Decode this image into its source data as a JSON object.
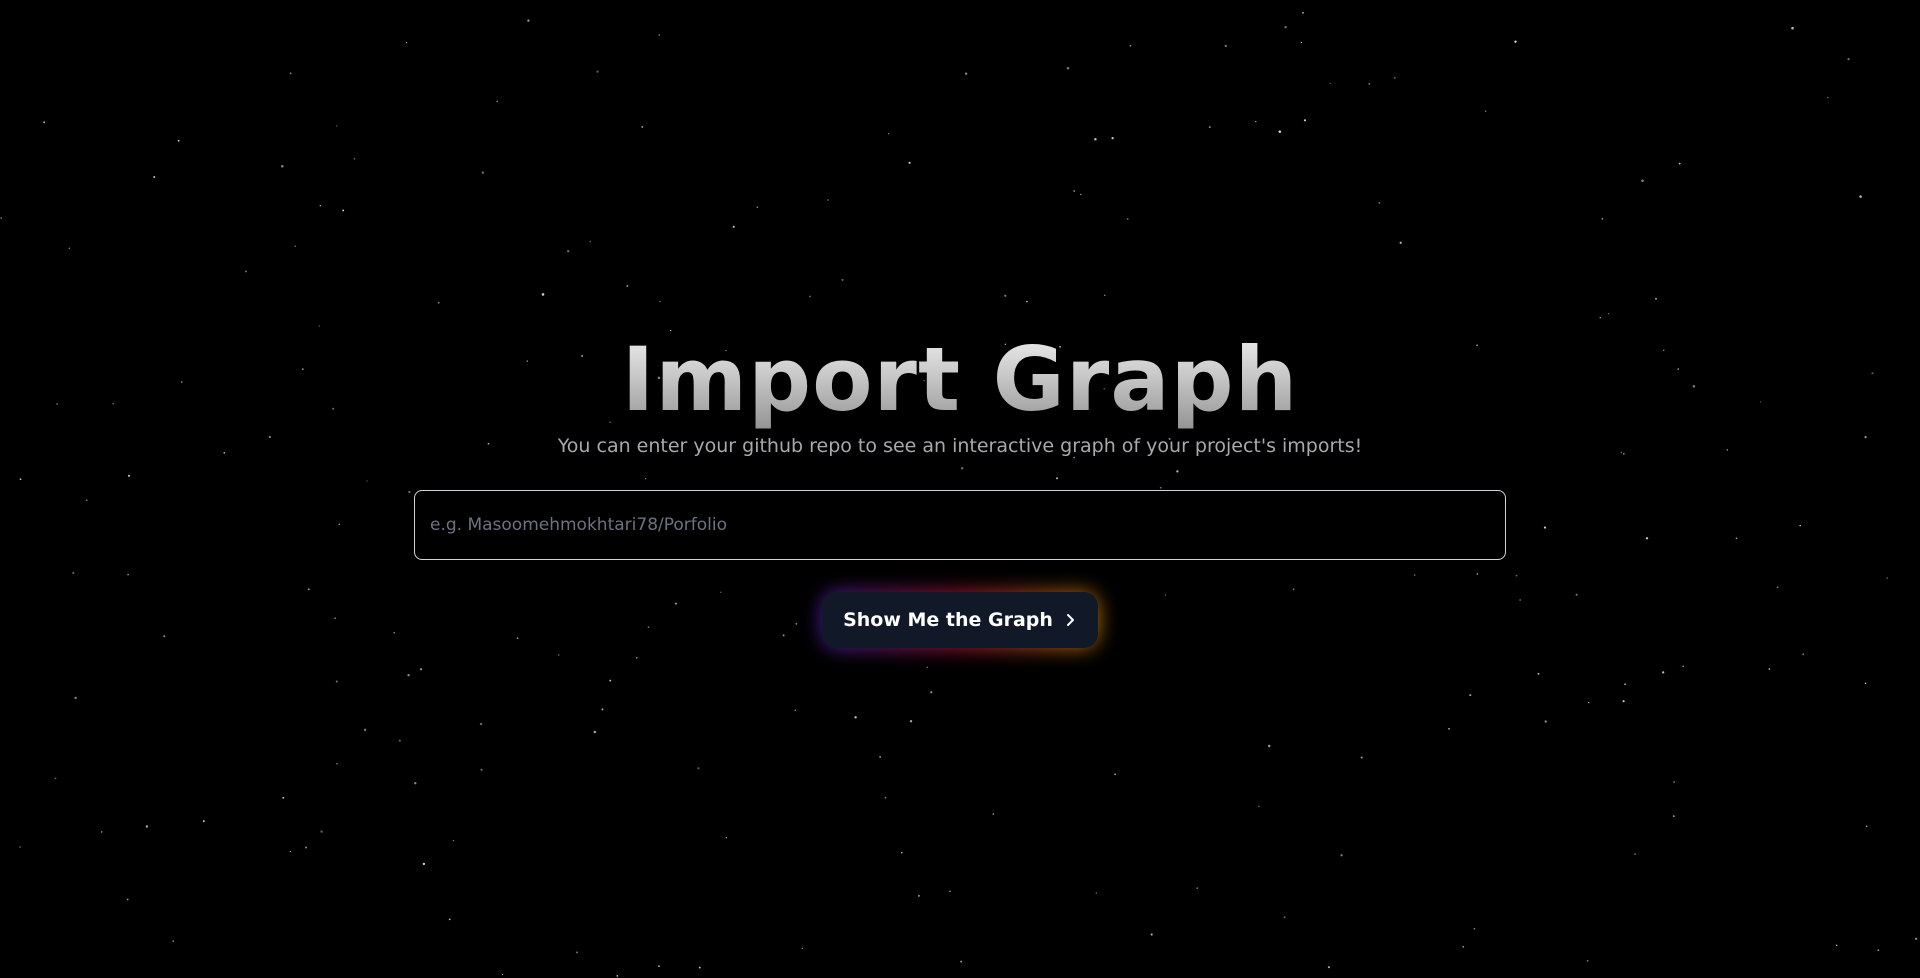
{
  "hero": {
    "title": "Import Graph",
    "subtitle": "You can enter your github repo to see an interactive graph of your project's imports!"
  },
  "repo_input": {
    "value": "",
    "placeholder": "e.g. Masoomehmokhtari78/Porfolio"
  },
  "submit_button": {
    "label": "Show Me the Graph",
    "icon": "chevron-right-icon"
  },
  "colors": {
    "background": "#000000",
    "button_bg": "#111827",
    "glow_start": "#5b2bd6",
    "glow_mid": "#e11d48",
    "glow_end": "#f59e0b",
    "subtitle": "#a8a8ad"
  }
}
